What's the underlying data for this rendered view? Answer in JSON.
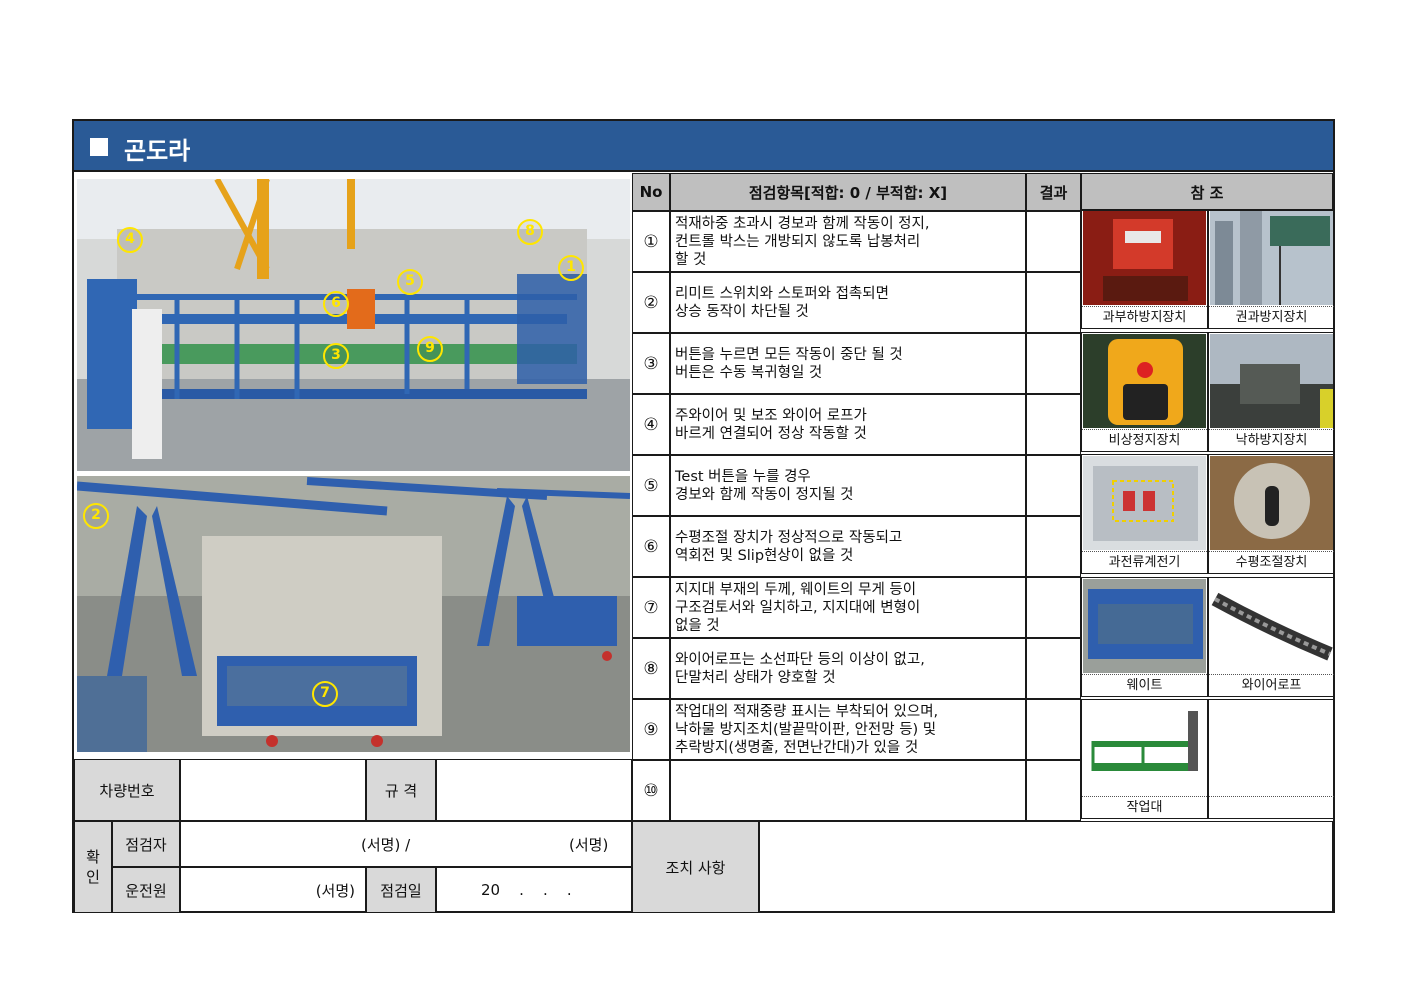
{
  "title": "곤도라",
  "photo_markers": {
    "top": [
      "4",
      "8",
      "1",
      "5",
      "6",
      "3",
      "9"
    ],
    "bottom": [
      "2",
      "7"
    ]
  },
  "info": {
    "vehicle_label": "차량번호",
    "spec_label": "규 격",
    "confirm_label": "확\n인",
    "inspector_label": "점검자",
    "inspector_sign": "(서명) /",
    "inspector_sign2": "(서명)",
    "operator_label": "운전원",
    "operator_sign": "(서명)",
    "date_label": "점검일",
    "date_value": "20    .    .    ."
  },
  "table": {
    "headers": {
      "no": "No",
      "item": "점검항목[적합: 0 / 부적합: X]",
      "result": "결과",
      "ref": "참 조"
    },
    "rows": [
      {
        "no": "①",
        "text": "적재하중 초과시 경보과 함께 작동이 정지,\n컨트롤 박스는 개방되지 않도록 납봉처리\n할 것"
      },
      {
        "no": "②",
        "text": "리미트 스위치와 스토퍼와 접촉되면\n상승 동작이 차단될 것"
      },
      {
        "no": "③",
        "text": "버튼을 누르면 모든 작동이 중단 될 것\n버튼은 수동 복귀형일 것"
      },
      {
        "no": "④",
        "text": "주와이어 및 보조 와이어 로프가\n바르게 연결되어 정상 작동할 것"
      },
      {
        "no": "⑤",
        "text": "Test 버튼을 누를 경우\n경보와 함께 작동이 정지될 것"
      },
      {
        "no": "⑥",
        "text": "수평조절 장치가 정상적으로 작동되고\n역회전 및 Slip현상이 없을 것"
      },
      {
        "no": "⑦",
        "text": "지지대 부재의 두께, 웨이트의 무게 등이\n구조검토서와 일치하고, 지지대에 변형이\n없을 것"
      },
      {
        "no": "⑧",
        "text": "와이어로프는 소선파단 등의 이상이 없고,\n단말처리 상태가 양호할 것"
      },
      {
        "no": "⑨",
        "text": "작업대의 적재중량 표시는 부착되어 있으며,\n낙하물 방지조치(발끝막이판, 안전망 등) 및\n추락방지(생명줄, 전면난간대)가 있을 것"
      },
      {
        "no": "⑩",
        "text": ""
      }
    ],
    "refs": [
      "과부하방지장치",
      "권과방지장치",
      "비상정지장치",
      "낙하방지장치",
      "과전류계전기",
      "수평조절장치",
      "웨이트",
      "와이어로프",
      "작업대",
      ""
    ]
  },
  "action_label": "조치 사항"
}
